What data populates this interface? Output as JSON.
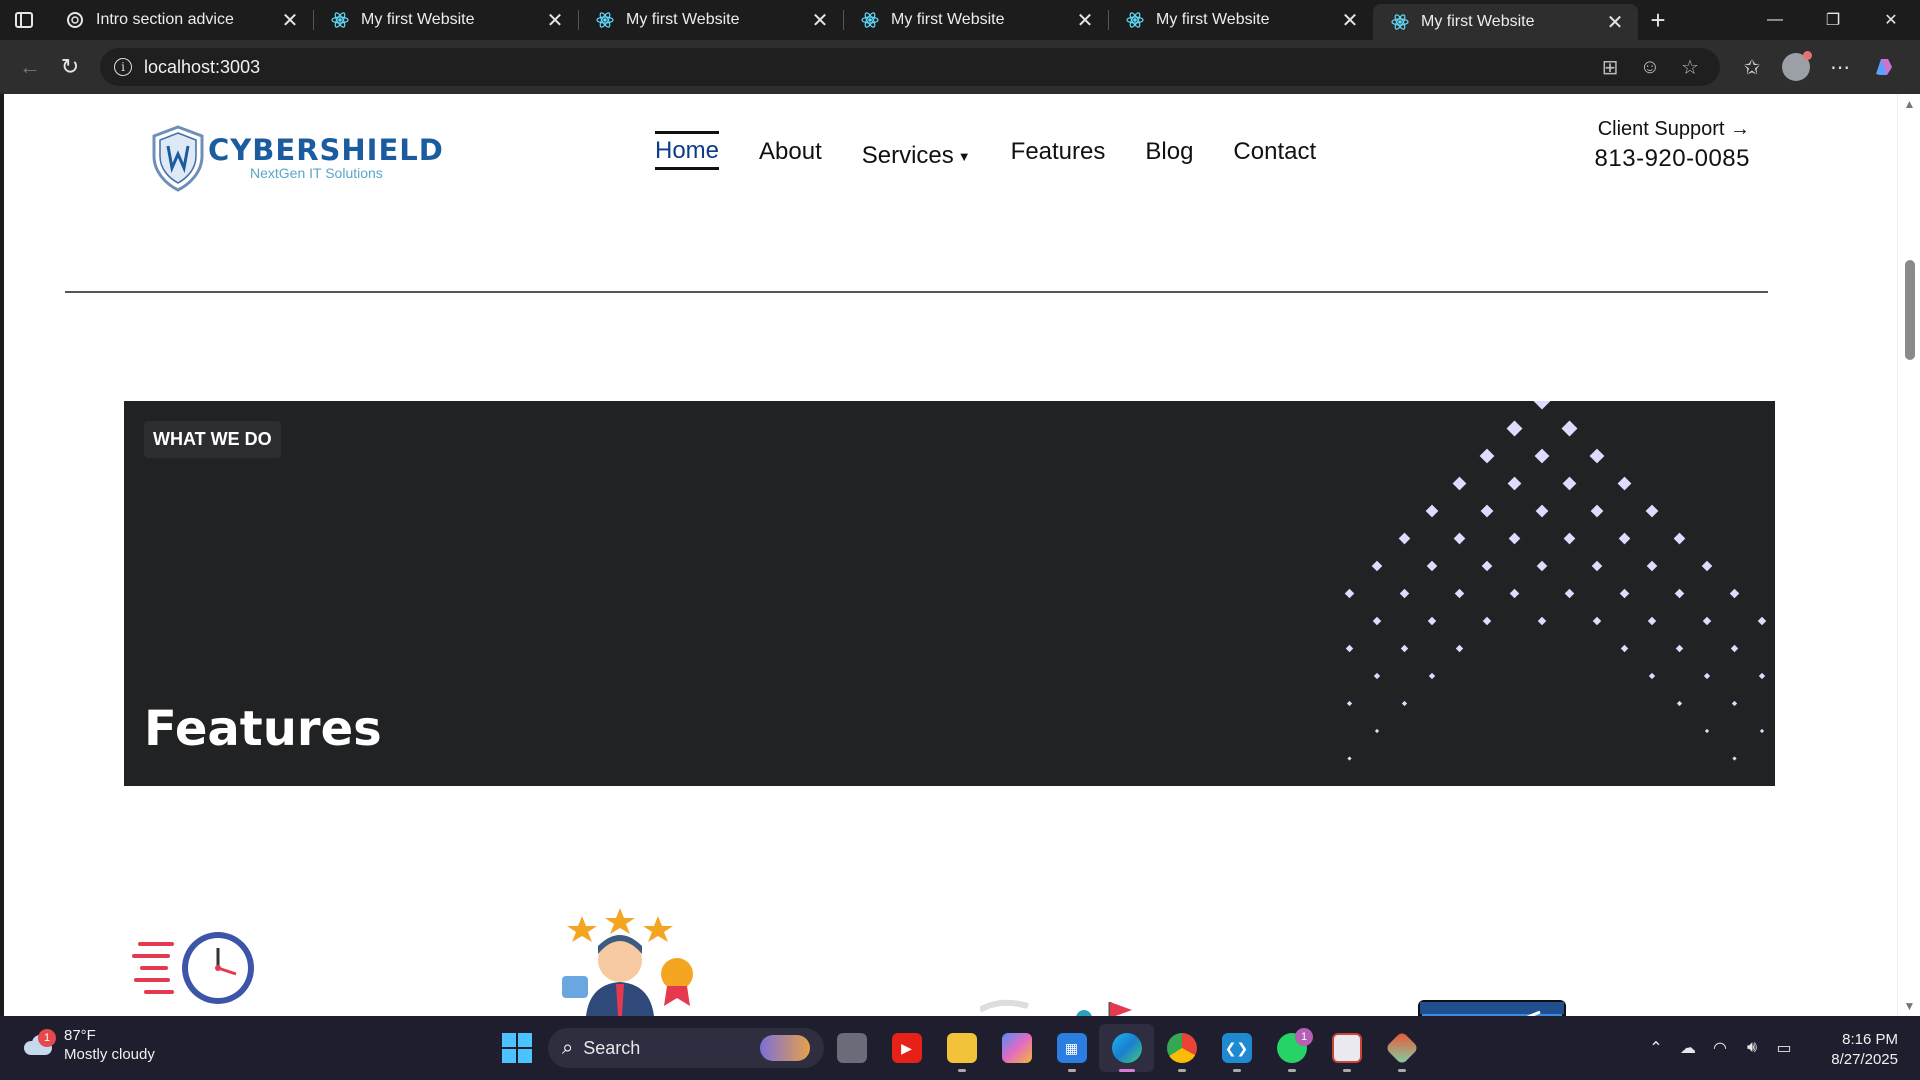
{
  "browser": {
    "tabs": [
      {
        "title": "Intro section advice",
        "icon": "openai-icon",
        "active": false
      },
      {
        "title": "My first Website",
        "icon": "react-icon",
        "active": false
      },
      {
        "title": "My first Website",
        "icon": "react-icon",
        "active": false
      },
      {
        "title": "My first Website",
        "icon": "react-icon",
        "active": false
      },
      {
        "title": "My first Website",
        "icon": "react-icon",
        "active": false
      },
      {
        "title": "My first Website",
        "icon": "react-icon",
        "active": true
      }
    ],
    "url": "localhost:3003"
  },
  "site": {
    "logo": {
      "brand": "CYBERSHIELD",
      "tagline": "NextGen IT Solutions"
    },
    "nav": [
      {
        "label": "Home",
        "active": true
      },
      {
        "label": "About"
      },
      {
        "label": "Services",
        "has_dropdown": true
      },
      {
        "label": "Features"
      },
      {
        "label": "Blog"
      },
      {
        "label": "Contact"
      }
    ],
    "support": {
      "label": "Client Support",
      "phone": "813-920-0085"
    },
    "band": {
      "eyebrow": "WHAT WE DO",
      "heading": "Features",
      "background": "#212224",
      "pattern_color": "#dcdcff"
    },
    "feature_icons": [
      "fast-clock-icon",
      "rated-professional-icon",
      "teamwork-goal-icon",
      "analytics-dashboard-icon"
    ]
  },
  "taskbar": {
    "weather": {
      "temp": "87°F",
      "condition": "Mostly cloudy",
      "badge": "1"
    },
    "search_placeholder": "Search",
    "apps": [
      {
        "name": "task-view-icon"
      },
      {
        "name": "youtube-icon"
      },
      {
        "name": "file-explorer-icon"
      },
      {
        "name": "copilot-icon"
      },
      {
        "name": "microsoft-store-icon"
      },
      {
        "name": "edge-icon",
        "active": true
      },
      {
        "name": "chrome-icon"
      },
      {
        "name": "vscode-icon"
      },
      {
        "name": "whatsapp-icon",
        "badge": "1"
      },
      {
        "name": "snipping-tool-icon"
      },
      {
        "name": "git-icon"
      }
    ],
    "time": "8:16 PM",
    "date": "8/27/2025"
  }
}
